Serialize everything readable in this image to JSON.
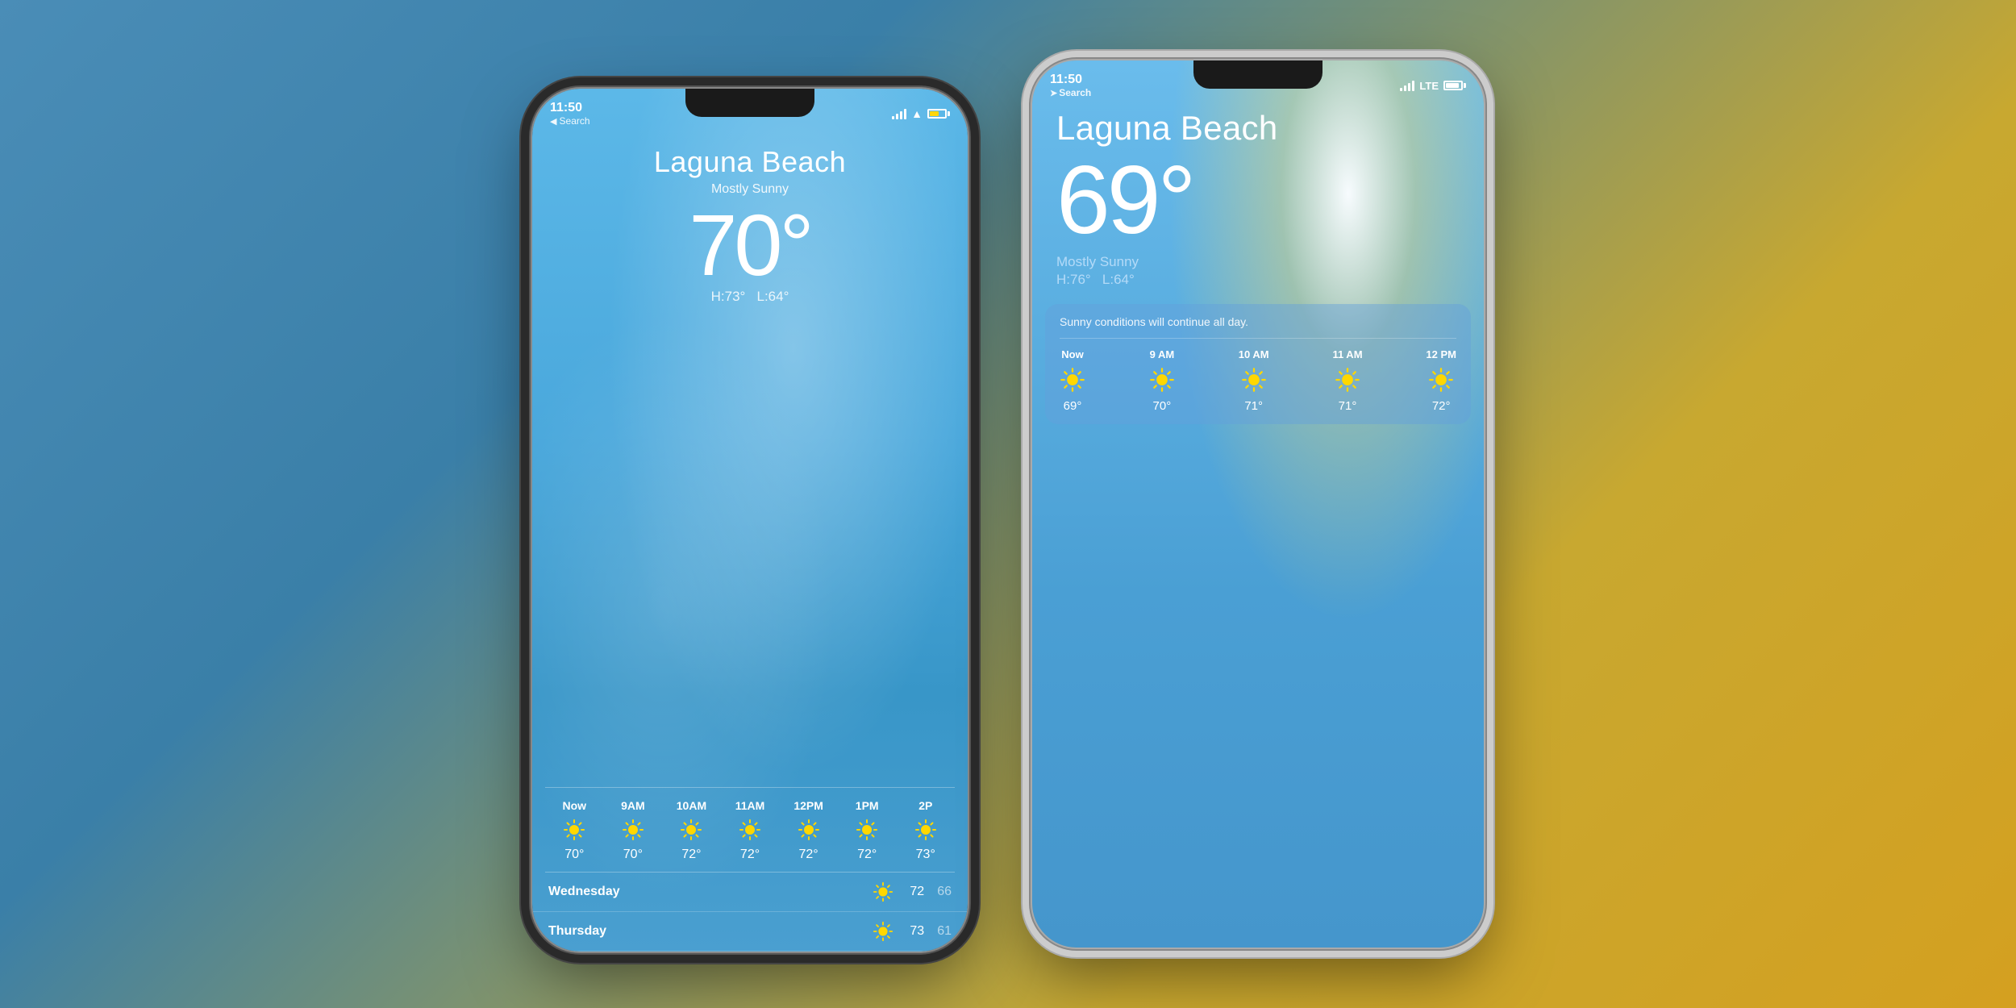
{
  "background": {
    "gradient": "linear-gradient(135deg, #4a8db7 0%, #3a7fa8 30%, #c8a830 70%, #d4a020 100%)"
  },
  "phone_left": {
    "status": {
      "time": "11:50",
      "search": "◀ Search",
      "signal": "full",
      "wifi": true,
      "battery_level": "60%",
      "battery_color": "#ffd60a"
    },
    "weather": {
      "city": "Laguna Beach",
      "condition": "Mostly Sunny",
      "temperature": "70°",
      "high": "H:73°",
      "low": "L:64°",
      "hourly": [
        {
          "label": "Now",
          "temp": "70°"
        },
        {
          "label": "9AM",
          "temp": "70°"
        },
        {
          "label": "10AM",
          "temp": "72°"
        },
        {
          "label": "11AM",
          "temp": "72°"
        },
        {
          "label": "12PM",
          "temp": "72°"
        },
        {
          "label": "1PM",
          "temp": "72°"
        },
        {
          "label": "2P",
          "temp": "73°"
        }
      ],
      "daily": [
        {
          "day": "Wednesday",
          "icon": "sun",
          "high": "72",
          "low": "66"
        },
        {
          "day": "Thursday",
          "icon": "sun",
          "high": "73",
          "low": "61"
        }
      ]
    }
  },
  "phone_right": {
    "status": {
      "time": "11:50",
      "location": true,
      "search": "◀ Search",
      "signal": "full",
      "lte": "LTE",
      "battery_level": "90%",
      "battery_color": "white"
    },
    "weather": {
      "city": "Laguna Beach",
      "temperature": "69°",
      "condition": "Mostly Sunny",
      "high": "H:76°",
      "low": "L:64°",
      "conditions_summary": "Sunny conditions will continue all day.",
      "hourly": [
        {
          "label": "Now",
          "temp": "69°"
        },
        {
          "label": "9 AM",
          "temp": "70°"
        },
        {
          "label": "10 AM",
          "temp": "71°"
        },
        {
          "label": "11 AM",
          "temp": "71°"
        },
        {
          "label": "12 PM",
          "temp": "72°"
        }
      ]
    }
  }
}
